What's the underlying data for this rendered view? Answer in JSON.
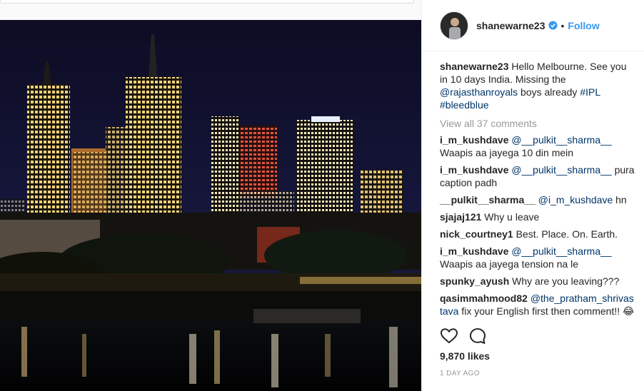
{
  "post": {
    "author": "shanewarne23",
    "follow_label": "Follow",
    "separator": "•",
    "caption": {
      "username": "shanewarne23",
      "text_1": " Hello Melbourne. See you in 10 days India. Missing the ",
      "mention": "@rajasthanroyals",
      "text_2": " boys already ",
      "tag_1": "#IPL",
      "text_3": " ",
      "tag_2": "#bleedblue"
    },
    "view_all_label": "View all 37 comments",
    "comments": [
      {
        "username": "i_m_kushdave",
        "mention": "@__pulkit__sharma__",
        "text": " Waapis aa jayega 10 din mein"
      },
      {
        "username": "i_m_kushdave",
        "mention": "@__pulkit__sharma__",
        "text": " pura caption padh"
      },
      {
        "username": "__pulkit__sharma__",
        "mention": "@i_m_kushdave",
        "text": " hn"
      },
      {
        "username": "sjajaj121",
        "mention": "",
        "text": " Why u leave"
      },
      {
        "username": "nick_courtney1",
        "mention": "",
        "text": " Best. Place. On. Earth."
      },
      {
        "username": "i_m_kushdave",
        "mention": "@__pulkit__sharma__",
        "text": " Waapis aa jayega tension na le"
      },
      {
        "username": "spunky_ayush",
        "mention": "",
        "text": " Why are you leaving???"
      },
      {
        "username": "qasimmahmood82",
        "mention": "@the_pratham_shrivastava",
        "text": " fix your English first then comment!! 😂"
      }
    ],
    "likes": "9,870 likes",
    "timestamp": "1 DAY AGO"
  },
  "colors": {
    "link_blue": "#3897f0",
    "mention_blue": "#003569",
    "muted_gray": "#999999",
    "verified_blue": "#3897f0"
  },
  "icons": {
    "verified": "verified-badge-icon",
    "like": "heart-outline-icon",
    "comment": "speech-bubble-icon"
  }
}
